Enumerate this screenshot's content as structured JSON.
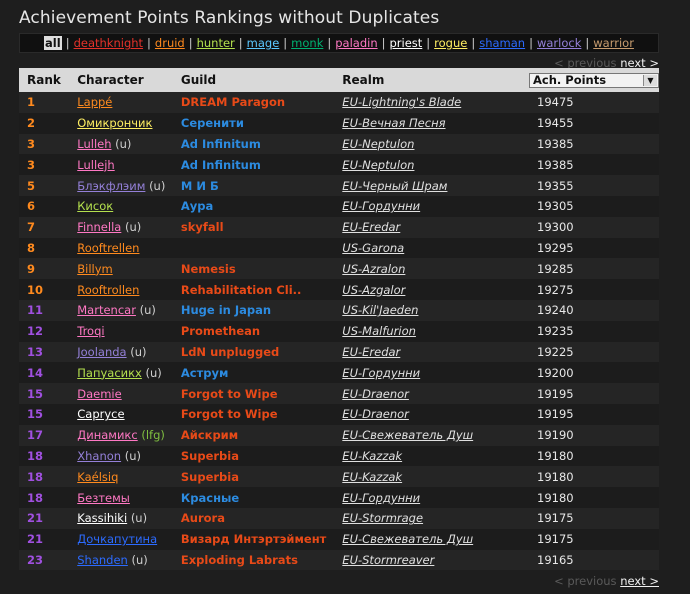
{
  "page": {
    "title": "Achievement Points Rankings without Duplicates"
  },
  "classes": [
    {
      "label": "all",
      "color": "#ffffff",
      "active": true
    },
    {
      "label": "deathknight",
      "color": "#e5322a"
    },
    {
      "label": "druid",
      "color": "#ff8a1e"
    },
    {
      "label": "hunter",
      "color": "#b4e04e"
    },
    {
      "label": "mage",
      "color": "#5cc8ff"
    },
    {
      "label": "monk",
      "color": "#00b070"
    },
    {
      "label": "paladin",
      "color": "#ff78c4"
    },
    {
      "label": "priest",
      "color": "#ffffff"
    },
    {
      "label": "rogue",
      "color": "#ffef62"
    },
    {
      "label": "shaman",
      "color": "#2c6bff"
    },
    {
      "label": "warlock",
      "color": "#9480d8"
    },
    {
      "label": "warrior",
      "color": "#c79c6e"
    }
  ],
  "pager": {
    "prev": "< previous",
    "next": "next >"
  },
  "table": {
    "headers": {
      "rank": "Rank",
      "character": "Character",
      "guild": "Guild",
      "realm": "Realm",
      "points": "Ach. Points"
    },
    "rows": [
      {
        "rank": "1",
        "rank_color": "#ff8a1e",
        "character": "Lappé",
        "char_color": "#ff8a1e",
        "suffix": "",
        "guild": "DREAM Paragon",
        "guild_color": "#e84a18",
        "realm": "EU-Lightning's Blade",
        "points": "19475"
      },
      {
        "rank": "2",
        "rank_color": "#ff8a1e",
        "character": "Омикрончик",
        "char_color": "#ffef62",
        "suffix": "",
        "guild": "Серенити",
        "guild_color": "#2c8be0",
        "realm": "EU-Вечная Песня",
        "points": "19455"
      },
      {
        "rank": "3",
        "rank_color": "#ff8a1e",
        "character": "Lulleh",
        "char_color": "#ff78c4",
        "suffix": "(u)",
        "guild": "Ad Infinitum",
        "guild_color": "#2c8be0",
        "realm": "EU-Neptulon",
        "points": "19385"
      },
      {
        "rank": "3",
        "rank_color": "#ff8a1e",
        "character": "Lullejh",
        "char_color": "#ff78c4",
        "suffix": "",
        "guild": "Ad Infinitum",
        "guild_color": "#2c8be0",
        "realm": "EU-Neptulon",
        "points": "19385"
      },
      {
        "rank": "5",
        "rank_color": "#ff8a1e",
        "character": "Блэкфлэим",
        "char_color": "#9480d8",
        "suffix": "(u)",
        "guild": "М И Б",
        "guild_color": "#2c8be0",
        "realm": "EU-Черный Шрам",
        "points": "19355"
      },
      {
        "rank": "6",
        "rank_color": "#ff8a1e",
        "character": "Кисок",
        "char_color": "#b4e04e",
        "suffix": "",
        "guild": "Аура",
        "guild_color": "#2c8be0",
        "realm": "EU-Гордунни",
        "points": "19305"
      },
      {
        "rank": "7",
        "rank_color": "#ff8a1e",
        "character": "Finnella",
        "char_color": "#ff78c4",
        "suffix": "(u)",
        "guild": "skyfall",
        "guild_color": "#e84a18",
        "realm": "EU-Eredar",
        "points": "19300"
      },
      {
        "rank": "8",
        "rank_color": "#ff8a1e",
        "character": "Rooftrellen",
        "char_color": "#ff8a1e",
        "suffix": "",
        "guild": "",
        "guild_color": "#e84a18",
        "realm": "US-Garona",
        "points": "19295"
      },
      {
        "rank": "9",
        "rank_color": "#ff8a1e",
        "character": "Billym",
        "char_color": "#ff8a1e",
        "suffix": "",
        "guild": "Nemesis",
        "guild_color": "#e84a18",
        "realm": "US-Azralon",
        "points": "19285"
      },
      {
        "rank": "10",
        "rank_color": "#ff8a1e",
        "character": "Rooftrollen",
        "char_color": "#ff8a1e",
        "suffix": "",
        "guild": "Rehabilitation Cli..",
        "guild_color": "#e84a18",
        "realm": "US-Azgalor",
        "points": "19275"
      },
      {
        "rank": "11",
        "rank_color": "#a050e0",
        "character": "Martencar",
        "char_color": "#ff78c4",
        "suffix": "(u)",
        "guild": "Huge in Japan",
        "guild_color": "#2c8be0",
        "realm": "US-Kil'Jaeden",
        "points": "19240"
      },
      {
        "rank": "12",
        "rank_color": "#a050e0",
        "character": "Troqi",
        "char_color": "#ff78c4",
        "suffix": "",
        "guild": "Promethean",
        "guild_color": "#e84a18",
        "realm": "US-Malfurion",
        "points": "19235"
      },
      {
        "rank": "13",
        "rank_color": "#a050e0",
        "character": "Joolanda",
        "char_color": "#9480d8",
        "suffix": "(u)",
        "guild": "LdN unplugged",
        "guild_color": "#e84a18",
        "realm": "EU-Eredar",
        "points": "19225"
      },
      {
        "rank": "14",
        "rank_color": "#a050e0",
        "character": "Папуасикх",
        "char_color": "#b4e04e",
        "suffix": "(u)",
        "guild": "Аструм",
        "guild_color": "#2c8be0",
        "realm": "EU-Гордунни",
        "points": "19200"
      },
      {
        "rank": "15",
        "rank_color": "#a050e0",
        "character": "Daemie",
        "char_color": "#ff78c4",
        "suffix": "",
        "guild": "Forgot to Wipe",
        "guild_color": "#e84a18",
        "realm": "EU-Draenor",
        "points": "19195"
      },
      {
        "rank": "15",
        "rank_color": "#a050e0",
        "character": "Сарryce",
        "char_color": "#ffffff",
        "suffix": "",
        "guild": "Forgot to Wipe",
        "guild_color": "#e84a18",
        "realm": "EU-Draenor",
        "points": "19195"
      },
      {
        "rank": "17",
        "rank_color": "#a050e0",
        "character": "Динамикс",
        "char_color": "#ff78c4",
        "suffix": "(lfg)",
        "guild": "Айскрим",
        "guild_color": "#e84a18",
        "realm": "EU-Свежеватель Душ",
        "points": "19190"
      },
      {
        "rank": "18",
        "rank_color": "#a050e0",
        "character": "Xhanon",
        "char_color": "#9480d8",
        "suffix": "(u)",
        "guild": "Superbia",
        "guild_color": "#e84a18",
        "realm": "EU-Kazzak",
        "points": "19180"
      },
      {
        "rank": "18",
        "rank_color": "#a050e0",
        "character": "Kaélsiq",
        "char_color": "#ff8a1e",
        "suffix": "",
        "guild": "Superbia",
        "guild_color": "#e84a18",
        "realm": "EU-Kazzak",
        "points": "19180"
      },
      {
        "rank": "18",
        "rank_color": "#a050e0",
        "character": "Безтемы",
        "char_color": "#ff78c4",
        "suffix": "",
        "guild": "Красные",
        "guild_color": "#2c8be0",
        "realm": "EU-Гордунни",
        "points": "19180"
      },
      {
        "rank": "21",
        "rank_color": "#a050e0",
        "character": "Kassihiki",
        "char_color": "#ffffff",
        "suffix": "(u)",
        "guild": "Aurora",
        "guild_color": "#e84a18",
        "realm": "EU-Stormrage",
        "points": "19175"
      },
      {
        "rank": "21",
        "rank_color": "#a050e0",
        "character": "Дочкапутина",
        "char_color": "#2c6bff",
        "suffix": "",
        "guild": "Визард Интэртэймент",
        "guild_color": "#e84a18",
        "realm": "EU-Свежеватель Душ",
        "points": "19175"
      },
      {
        "rank": "23",
        "rank_color": "#a050e0",
        "character": "Shanden",
        "char_color": "#2c6bff",
        "suffix": "(u)",
        "guild": "Exploding Labrats",
        "guild_color": "#e84a18",
        "realm": "EU-Stormreaver",
        "points": "19165"
      }
    ]
  }
}
